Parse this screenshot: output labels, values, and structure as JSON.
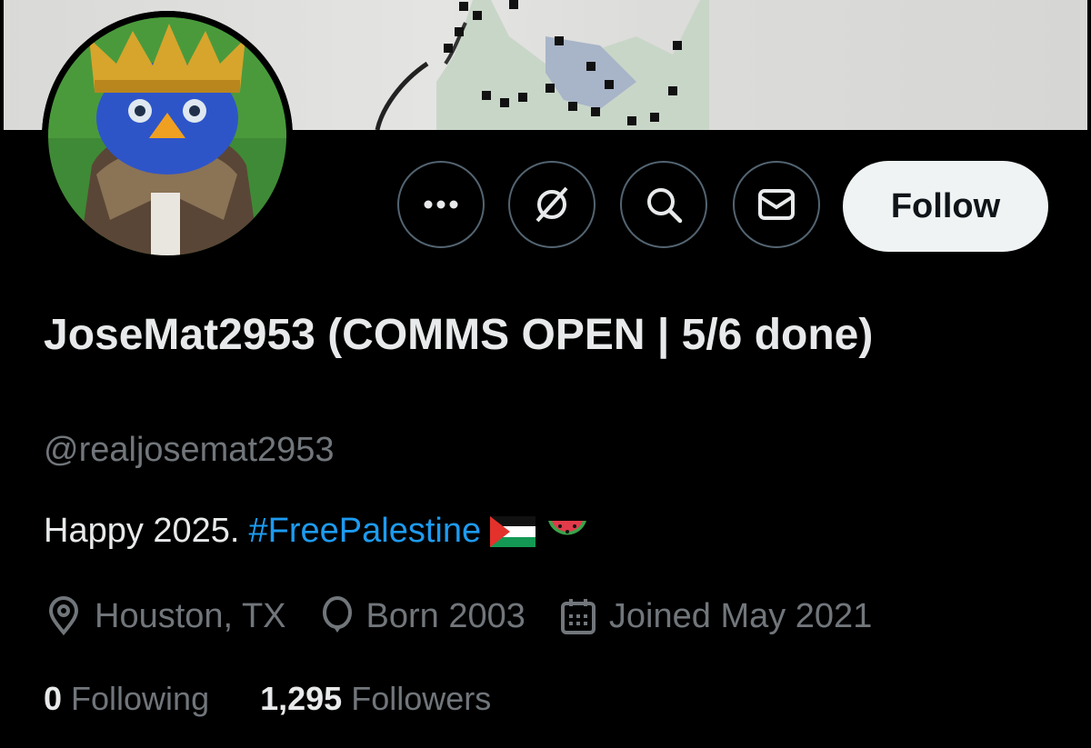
{
  "profile": {
    "display_name": "JoseMat2953 (COMMS OPEN | 5/6 done)",
    "handle": "@realjosemat2953",
    "bio_text": "Happy 2025.",
    "bio_hashtag": "#FreePalestine"
  },
  "actions": {
    "more_icon": "more-icon",
    "grok_icon": "grok-icon",
    "search_icon": "search-icon",
    "message_icon": "message-icon",
    "follow_label": "Follow"
  },
  "meta": {
    "location": "Houston, TX",
    "birth": "Born 2003",
    "joined": "Joined May 2021"
  },
  "stats": {
    "following_count": "0",
    "following_label": "Following",
    "followers_count": "1,295",
    "followers_label": "Followers"
  },
  "colors": {
    "background": "#000000",
    "text": "#e7e9ea",
    "secondary": "#71767b",
    "accent": "#1d9bf0",
    "button_bg": "#eff3f4"
  }
}
